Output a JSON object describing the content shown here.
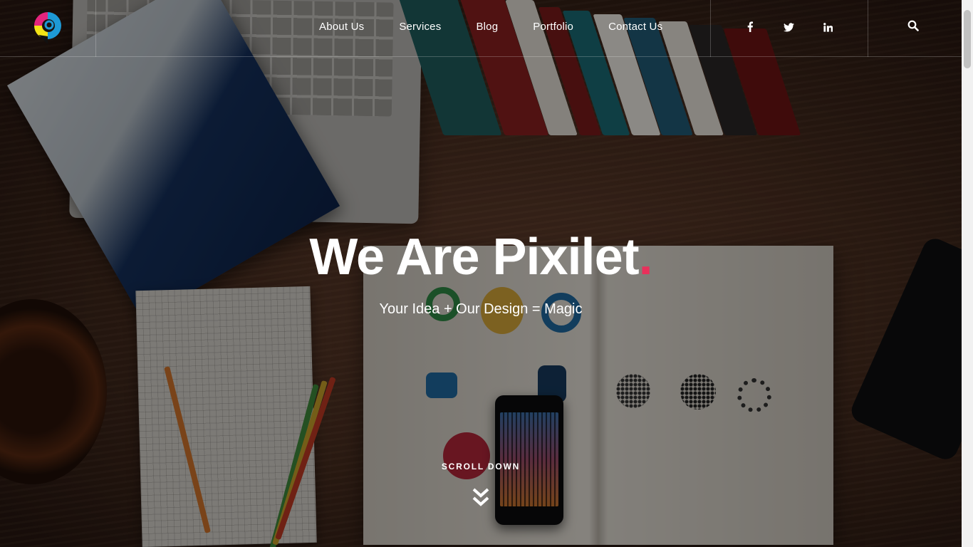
{
  "brand": {
    "logo_icon": "pixilet-logo-icon",
    "accent": "#e8305b"
  },
  "nav": {
    "items": [
      {
        "label": "About Us"
      },
      {
        "label": "Services"
      },
      {
        "label": "Blog"
      },
      {
        "label": "Portfolio"
      },
      {
        "label": "Contact Us"
      }
    ]
  },
  "social": {
    "items": [
      {
        "icon": "facebook-icon"
      },
      {
        "icon": "twitter-icon"
      },
      {
        "icon": "linkedin-icon"
      }
    ]
  },
  "search": {
    "icon": "search-icon"
  },
  "hero": {
    "title": "We Are Pixilet",
    "title_dot": ".",
    "subtitle": "Your Idea + Our Design = Magic",
    "scroll_label": "SCROLL DOWN",
    "scroll_icon": "double-chevron-down-icon"
  }
}
